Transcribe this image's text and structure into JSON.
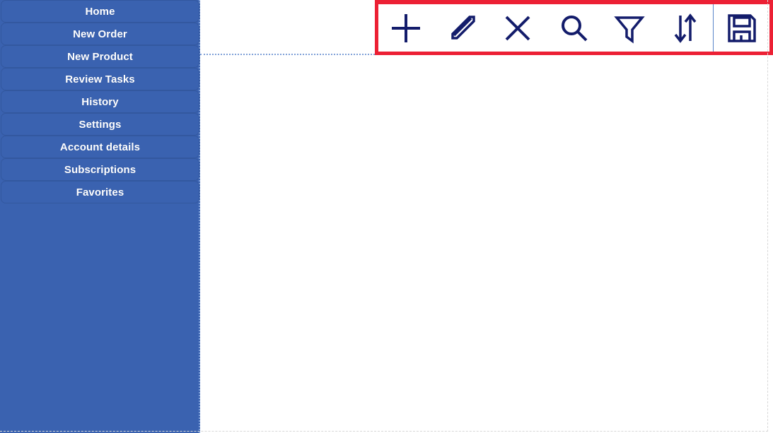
{
  "app": {
    "accent_blue": "#3a62b0",
    "icon_navy": "#131c6b",
    "highlight_red": "#ec2034",
    "separator_blue": "#5b86c9",
    "dotted_blue": "#7fa0d8",
    "page_background": "#ffffff"
  },
  "sidebar": {
    "items": [
      {
        "label": "Home",
        "name": "sidebar-item-home"
      },
      {
        "label": "New Order",
        "name": "sidebar-item-new-order"
      },
      {
        "label": "New Product",
        "name": "sidebar-item-new-product"
      },
      {
        "label": "Review Tasks",
        "name": "sidebar-item-review-tasks"
      },
      {
        "label": "History",
        "name": "sidebar-item-history"
      },
      {
        "label": "Settings",
        "name": "sidebar-item-settings"
      },
      {
        "label": "Account details",
        "name": "sidebar-item-account-details"
      },
      {
        "label": "Subscriptions",
        "name": "sidebar-item-subscriptions"
      },
      {
        "label": "Favorites",
        "name": "sidebar-item-favorites"
      }
    ]
  },
  "toolbar": {
    "highlighted": true,
    "buttons": [
      {
        "icon": "plus-icon",
        "label": "Add"
      },
      {
        "icon": "pencil-icon",
        "label": "Edit"
      },
      {
        "icon": "close-x-icon",
        "label": "Delete"
      },
      {
        "icon": "search-icon",
        "label": "Search"
      },
      {
        "icon": "filter-funnel-icon",
        "label": "Filter"
      },
      {
        "icon": "sort-arrows-icon",
        "label": "Sort"
      },
      {
        "icon": "save-floppy-icon",
        "label": "Save"
      }
    ]
  },
  "main": {
    "content": ""
  }
}
